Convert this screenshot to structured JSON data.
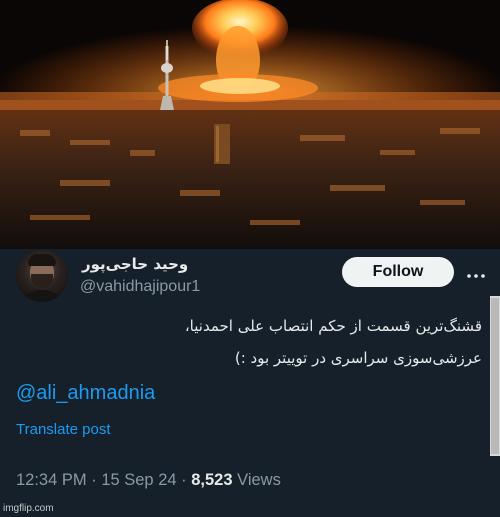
{
  "tweet": {
    "display_name": "وحید حاجی‌پور",
    "handle": "@vahidhajipour1",
    "follow_label": "Follow",
    "text_line_1": "قشنگ‌ترین قسمت از حکم انتصاب علی احمدنیا،",
    "text_line_2": "عرزشی‌سوزی سراسری در توییتر بود :)",
    "mention": "@ali_ahmadnia",
    "translate_label": "Translate post",
    "time": "12:34 PM",
    "separator": "·",
    "date": "15 Sep 24",
    "views_count": "8,523",
    "views_label": "Views"
  },
  "watermark": "imgflip.com",
  "colors": {
    "background": "#15202b",
    "link": "#1d9bf0",
    "text_primary": "#e7e9ea",
    "text_secondary": "#8b98a5",
    "follow_bg": "#eff3f4"
  },
  "icons": {
    "more": "more-dots-icon"
  }
}
